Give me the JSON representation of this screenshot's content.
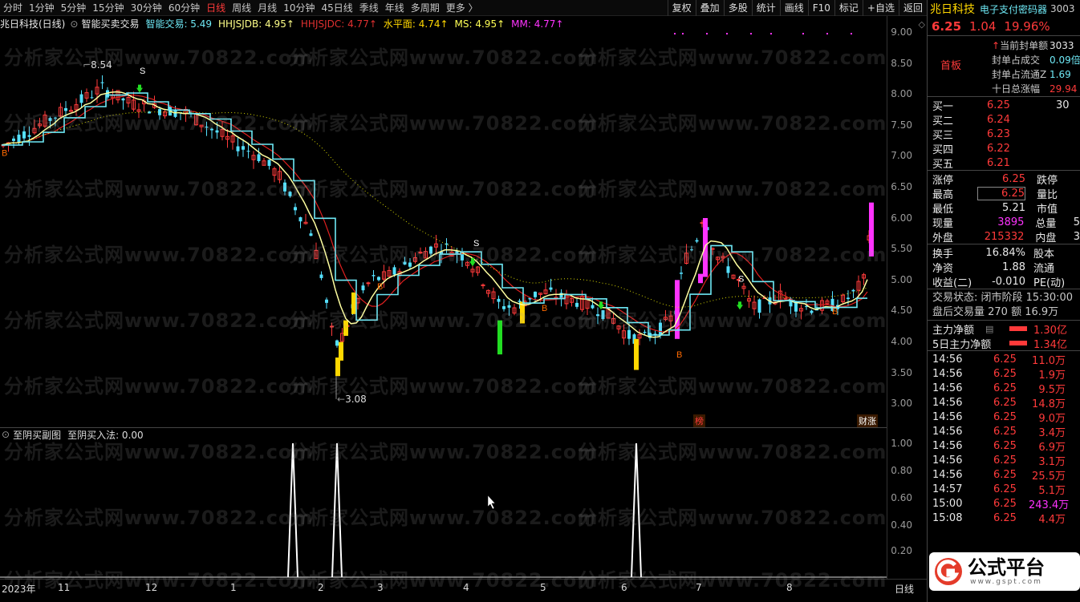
{
  "toolbar": {
    "periods": [
      "分时",
      "1分钟",
      "5分钟",
      "15分钟",
      "30分钟",
      "60分钟",
      "日线",
      "周线",
      "月线",
      "10分钟",
      "45日线",
      "季线",
      "年线",
      "多周期",
      "更多 〉"
    ],
    "active_index": 6,
    "right_buttons": [
      "复权",
      "叠加",
      "多股",
      "统计",
      "画线",
      "F10",
      "标记",
      "+自选",
      "返回"
    ]
  },
  "indicator": {
    "stock": "兆日科技(日线)",
    "formula": "智能买卖交易",
    "zn": "智能交易: 5.49",
    "hhjsjdb": "HHJSJDB: 4.95↑",
    "hhjsjdc": "HHJSJDC: 4.77↑",
    "spm": "水平面: 4.74↑",
    "ms": "MS: 4.95↑",
    "mm": "MM: 4.77↑"
  },
  "price_axis": [
    "9.00",
    "8.50",
    "8.00",
    "7.50",
    "7.00",
    "6.50",
    "6.00",
    "5.50",
    "5.00",
    "4.50",
    "4.00",
    "3.50",
    "3.00"
  ],
  "annotations": {
    "high": "8.54",
    "low": "3.08",
    "tag1": "榜",
    "tag2": "财涨"
  },
  "sub": {
    "title": "至阴买副图",
    "value": "至阴买入法: 0.00",
    "axis": [
      "1.00",
      "0.80",
      "0.60",
      "0.40",
      "0.20"
    ]
  },
  "dates": [
    "2023年",
    "11",
    "12",
    "1",
    "2",
    "3",
    "4",
    "5",
    "6",
    "7",
    "8",
    "日线"
  ],
  "watermark": "分析家公式网www.70822.com",
  "quote": {
    "name": "兆日科技",
    "sector": "电子支付密码器",
    "code": "3003",
    "price": "6.25",
    "change": "1.04",
    "pct": "19.96%",
    "board": "首板",
    "seal_labels": [
      "当前封单额",
      "封单占成交",
      "封单占流通Z",
      "十日总涨幅"
    ],
    "seal_values": [
      "3033",
      "0.09倍",
      "1.69",
      "29.94"
    ],
    "bids": [
      {
        "l": "买一",
        "p": "6.25",
        "v": "30"
      },
      {
        "l": "买二",
        "p": "6.24",
        "v": ""
      },
      {
        "l": "买三",
        "p": "6.23",
        "v": ""
      },
      {
        "l": "买四",
        "p": "6.22",
        "v": ""
      },
      {
        "l": "买五",
        "p": "6.21",
        "v": ""
      }
    ],
    "stats": [
      {
        "l": "涨停",
        "v": "6.25",
        "l2": "跌停",
        "v2": ""
      },
      {
        "l": "最高",
        "v": "6.25",
        "l2": "量比",
        "v2": ""
      },
      {
        "l": "最低",
        "v": "5.21",
        "l2": "市值",
        "v2": ""
      },
      {
        "l": "现量",
        "v": "3895",
        "l2": "总量",
        "v2": "5"
      },
      {
        "l": "外盘",
        "v": "215332",
        "l2": "内盘",
        "v2": "3"
      }
    ],
    "stats2": [
      {
        "l": "换手",
        "v": "16.84%",
        "l2": "股本"
      },
      {
        "l": "净资",
        "v": "1.88",
        "l2": "流通"
      },
      {
        "l": "收益(二)",
        "v": "-0.010",
        "l2": "PE(动)"
      }
    ],
    "status": "交易状态: 闭市阶段 15:30:00",
    "after": "盘后交易量 270 额 16.9万",
    "flow": [
      {
        "l": "主力净额",
        "v": "1.30亿"
      },
      {
        "l": "5日主力净额",
        "v": "1.34亿"
      }
    ],
    "ticks": [
      {
        "t": "14:56",
        "p": "6.25",
        "v": "11.0万"
      },
      {
        "t": "14:56",
        "p": "6.25",
        "v": "1.9万"
      },
      {
        "t": "14:56",
        "p": "6.25",
        "v": "9.5万"
      },
      {
        "t": "14:56",
        "p": "6.25",
        "v": "14.8万"
      },
      {
        "t": "14:56",
        "p": "6.25",
        "v": "9.0万"
      },
      {
        "t": "14:56",
        "p": "6.25",
        "v": "3.4万"
      },
      {
        "t": "14:56",
        "p": "6.25",
        "v": "6.9万"
      },
      {
        "t": "14:56",
        "p": "6.25",
        "v": "3.1万"
      },
      {
        "t": "14:56",
        "p": "6.25",
        "v": "25.5万"
      },
      {
        "t": "14:57",
        "p": "6.25",
        "v": "5.1万"
      },
      {
        "t": "15:00",
        "p": "6.25",
        "v": "243.4万"
      },
      {
        "t": "15:08",
        "p": "6.25",
        "v": "4.4万"
      }
    ]
  },
  "logo": {
    "text": "公式平台",
    "url": "www.gspt.com"
  },
  "colors": {
    "up": "#ff3a3a",
    "down": "#55e0ff",
    "yellow": "#ffff88",
    "red_ma": "#e02020",
    "cyan_line": "#6ee8f5",
    "magenta": "#ff33ff"
  }
}
